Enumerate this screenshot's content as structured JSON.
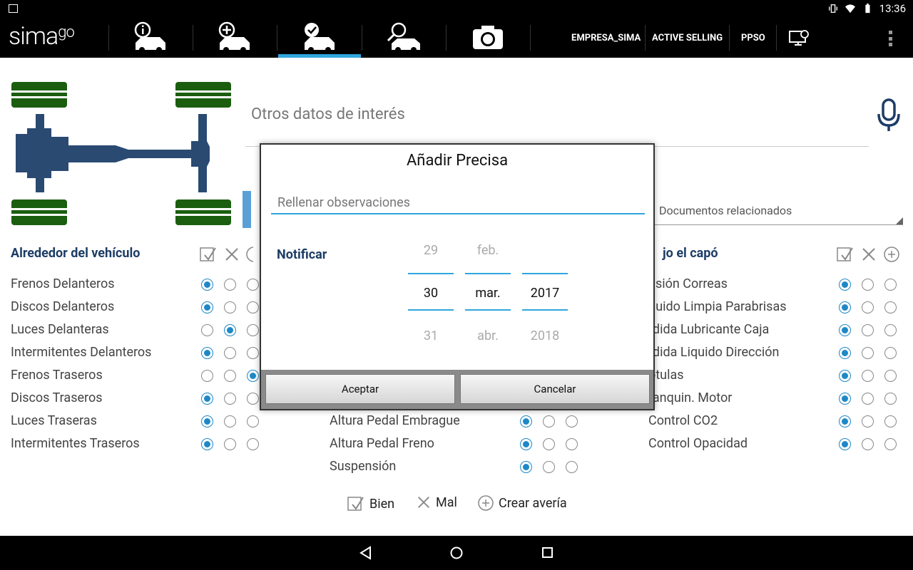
{
  "status_bar": {
    "time": "13:36"
  },
  "app": {
    "logo_text": "sima",
    "logo_suffix": "go"
  },
  "toolbar": {
    "tabs": [
      {
        "name": "vehicle-info",
        "active": false
      },
      {
        "name": "add-vehicle",
        "active": false
      },
      {
        "name": "inspection",
        "active": true
      },
      {
        "name": "search-vehicle",
        "active": false
      },
      {
        "name": "camera",
        "active": false
      }
    ],
    "company": "EMPRESA_SIMA",
    "active_selling": "ACTIVE SELLING",
    "ppso": "PPSO"
  },
  "main": {
    "otros_label": "Otros datos de interés",
    "docs_label": "Documentos relacionados",
    "left_section": {
      "title": "Alrededor del vehículo",
      "rows": [
        {
          "label": "Frenos Delanteros",
          "state": 0
        },
        {
          "label": "Discos Delanteros",
          "state": 0
        },
        {
          "label": "Luces Delanteras",
          "state": 1
        },
        {
          "label": "Intermitentes Delanteros",
          "state": 0
        },
        {
          "label": "Frenos Traseros",
          "state": 2
        },
        {
          "label": "Discos Traseros",
          "state": 0
        },
        {
          "label": "Luces Traseras",
          "state": 0
        },
        {
          "label": "Intermitentes Traseros",
          "state": 0
        }
      ]
    },
    "middle_section": {
      "rows": [
        {
          "label": "Altura Pedal Embrague",
          "state": 0
        },
        {
          "label": "Altura Pedal Freno",
          "state": 0
        },
        {
          "label": "Suspensión",
          "state": 0
        }
      ]
    },
    "right_section": {
      "title": "jo el capó",
      "rows": [
        {
          "label": "nsión Correas",
          "state": 0
        },
        {
          "label": "quido Limpia Parabrisas",
          "state": 0
        },
        {
          "label": "rdida Lubricante Caja",
          "state": 0
        },
        {
          "label": "rdida Liquido Dirección",
          "state": 0
        },
        {
          "label": "otulas",
          "state": 0
        },
        {
          "label": "tanquin. Motor",
          "state": 0
        },
        {
          "label": "Control CO2",
          "state": 0
        },
        {
          "label": "Control Opacidad",
          "state": 0
        }
      ]
    },
    "legend": {
      "bien": "Bien",
      "mal": "Mal",
      "crear": "Crear avería"
    }
  },
  "dialog": {
    "title": "Añadir Precisa",
    "input_placeholder": "Rellenar observaciones",
    "notify_label": "Notificar",
    "day": {
      "prev": "29",
      "current": "30",
      "next": "31"
    },
    "month": {
      "prev": "feb.",
      "current": "mar.",
      "next": "abr."
    },
    "year": {
      "prev": "",
      "current": "2017",
      "next": "2018"
    },
    "accept": "Aceptar",
    "cancel": "Cancelar"
  },
  "colors": {
    "accent": "#2fa6dd",
    "title_blue": "#1d3d66",
    "radio_on": "#1e88c7",
    "chassis_blue": "#2a4a72",
    "tire_green": "#1b5e10"
  }
}
